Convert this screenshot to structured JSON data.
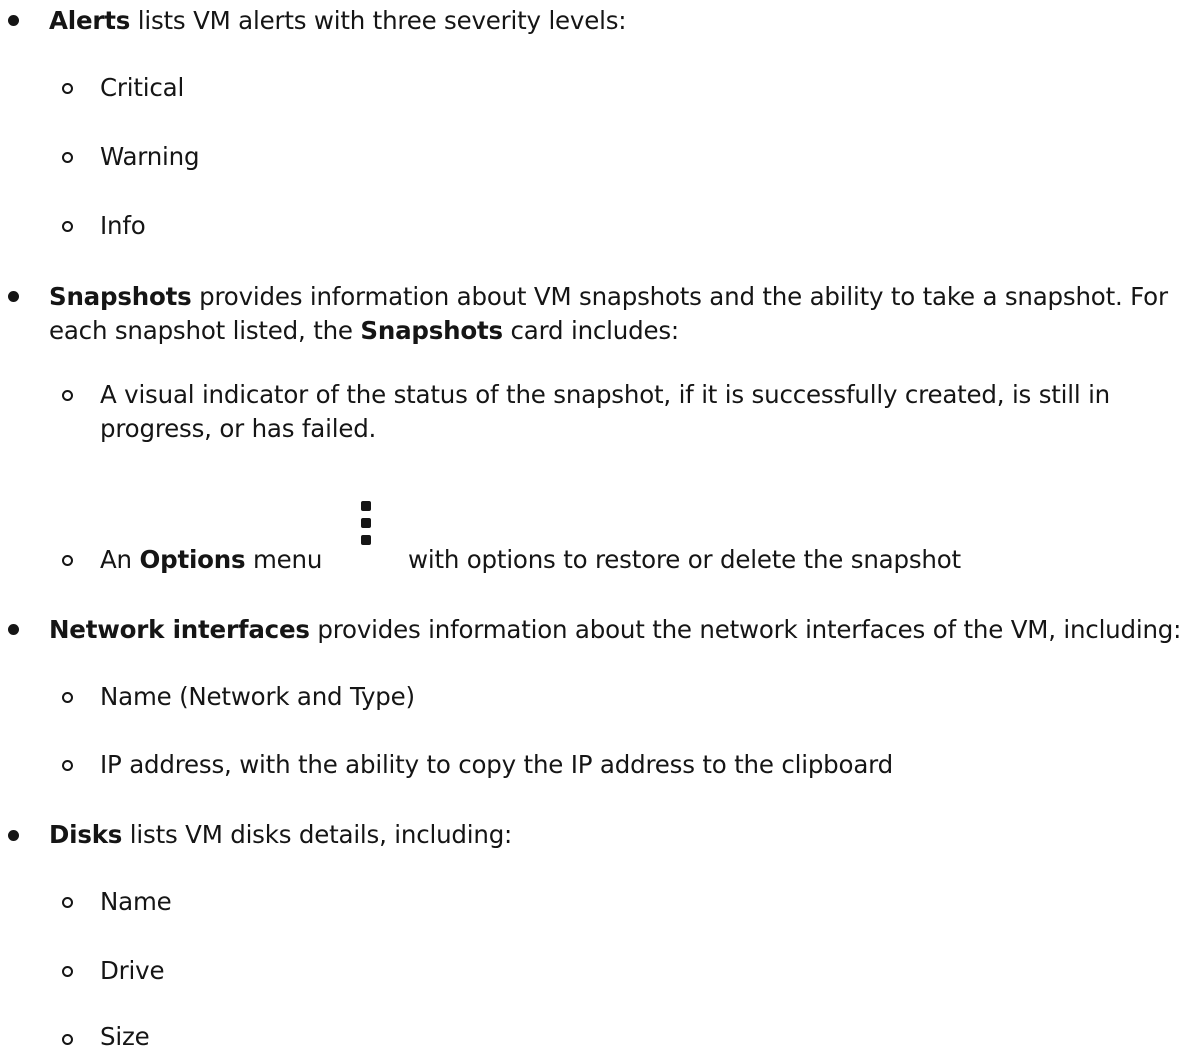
{
  "items": [
    {
      "term": "Alerts",
      "text": " lists VM alerts with three severity levels:",
      "subitems": [
        "Critical",
        "Warning",
        "Info"
      ]
    },
    {
      "term": "Snapshots",
      "text_line1": " provides information about VM snapshots and the ability to take a snapshot. For",
      "text_line2_pre": "each snapshot listed, the ",
      "text_line2_term": "Snapshots",
      "text_line2_post": " card includes:",
      "sub1_line1": "A visual indicator of the status of the snapshot, if it is successfully created, is still in",
      "sub1_line2": "progress, or has failed.",
      "sub2_pre": "An ",
      "sub2_term": "Options",
      "sub2_mid": " menu",
      "sub2_post": "with options to restore or delete the snapshot",
      "sub2_icon": "kebab-icon"
    },
    {
      "term": "Network interfaces",
      "text": " provides information about the network interfaces of the VM, including:",
      "subitems": [
        "Name (Network and Type)",
        "IP address, with the ability to copy the IP address to the clipboard"
      ]
    },
    {
      "term": "Disks",
      "text": " lists VM disks details, including:",
      "subitems": [
        "Name",
        "Drive",
        "Size"
      ]
    }
  ]
}
